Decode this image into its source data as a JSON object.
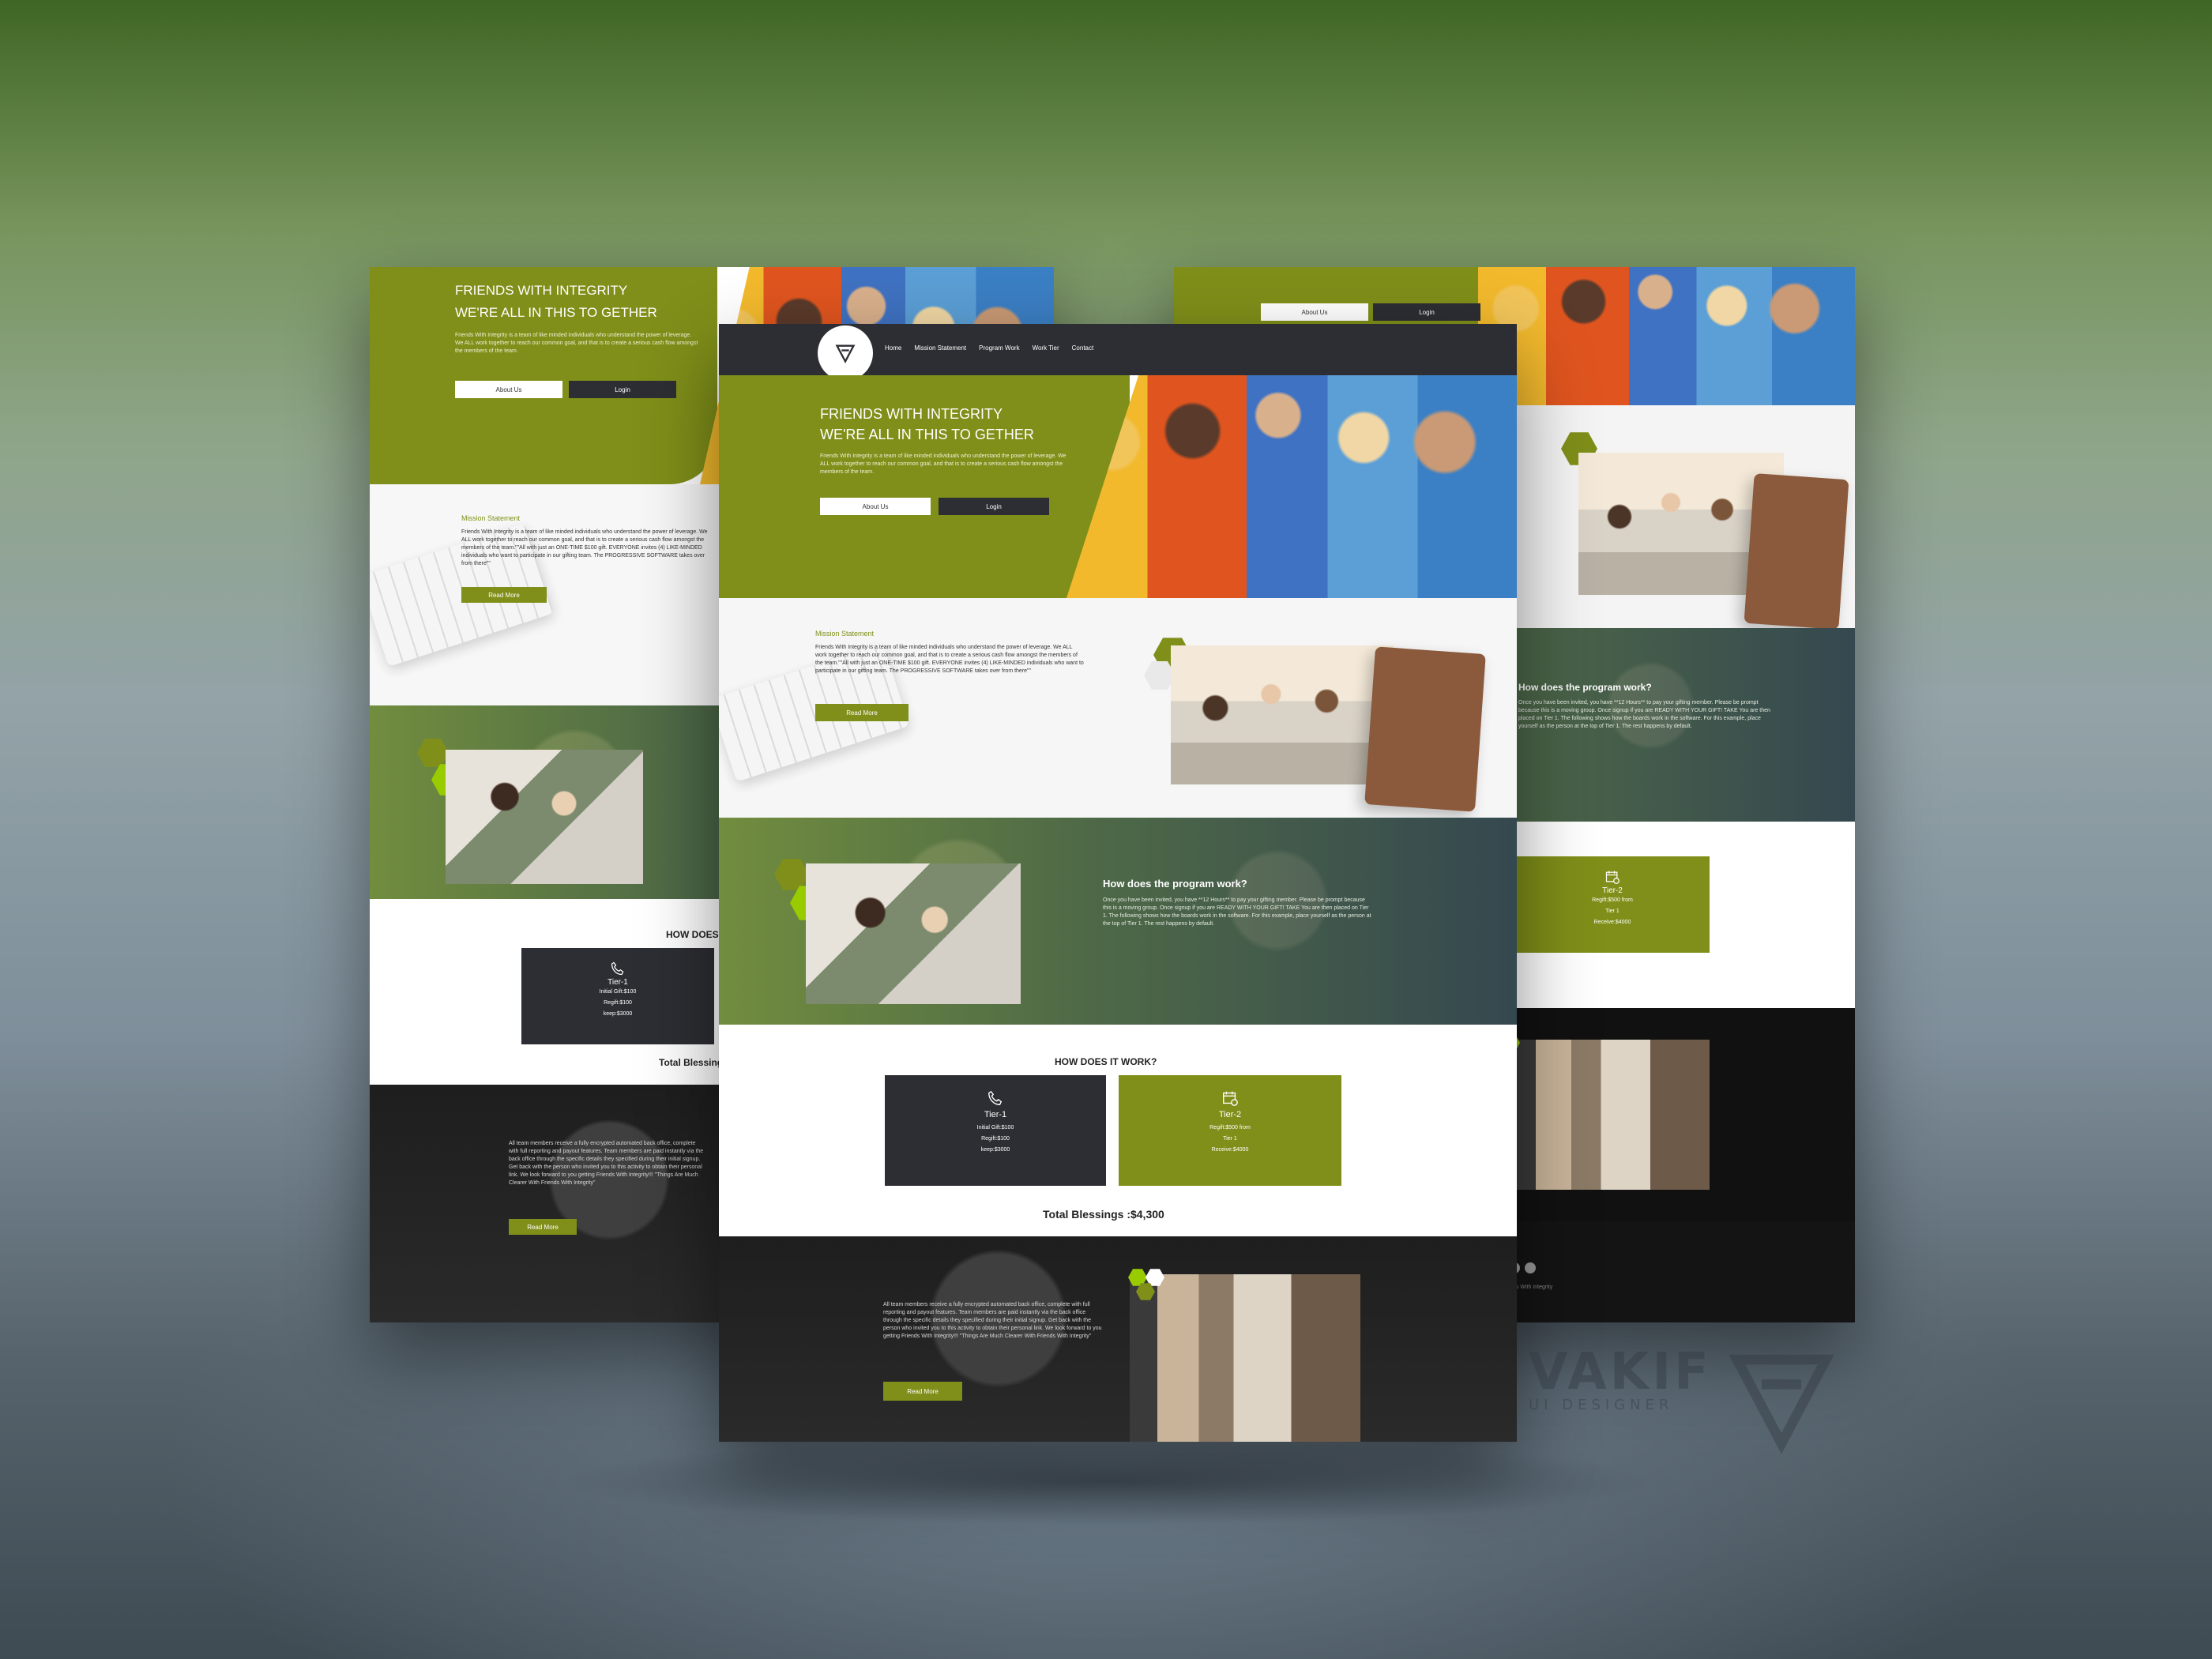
{
  "brand": {
    "green": "#7f8f19",
    "green_dark": "#66771a",
    "dark": "#2d2e33",
    "lime": "#99cc00",
    "logo_icon": "triangle-logo-icon"
  },
  "nav": {
    "items": [
      "Home",
      "Mission Statement",
      "Program Work",
      "Work Tier",
      "Contact"
    ]
  },
  "hero": {
    "title_line1": "FRIENDS WITH INTEGRITY",
    "title_line2": "WE'RE ALL IN THIS TO GETHER",
    "body": "Friends With Integrity is a team of like minded individuals who understand the power of leverage. We ALL work together to reach our common goal, and that is to create a serious cash flow amongst the members of the team.",
    "about_button": "About Us",
    "login_button": "Login"
  },
  "mission": {
    "heading": "Mission Statement",
    "body": "Friends With Integrity is a team of like minded individuals who understand the power of leverage. We ALL work together to reach our common goal, and that is to create a serious cash flow amongst the members of the team.\"\"All with just an ONE-TIME $100 gift. EVERYONE invites (4) LIKE-MINDED individuals who want to participate in our gifting team. The PROGRESSIVE SOFTWARE takes over from there\"\"",
    "read_more": "Read More"
  },
  "program": {
    "heading": "How does the program work?",
    "body": "Once you have been invited, you have **12 Hours** to pay your gifting member. Please be prompt because this is a moving group. Once signup if you are READY WITH YOUR GIFT! TAKE You are then placed on Tier 1. The following shows how the boards work in the software. For this example, place yourself as the person at the top of Tier 1. The rest happens by default."
  },
  "tiers": {
    "heading": "HOW DOES IT WORK?",
    "tier1": {
      "icon": "phone-gift-icon",
      "title": "Tier-1",
      "lines": [
        "Initial Gift:$100",
        "Regift:$100",
        "keep:$3000"
      ]
    },
    "tier2": {
      "icon": "calendar-plus-icon",
      "title": "Tier-2",
      "lines": [
        "Regift:$500 from",
        "Tier 1",
        "Receive:$4000"
      ]
    },
    "total": "Total Blessings :$4,300"
  },
  "team": {
    "body": "All team members receive a fully encrypted automated back office, complete with full reporting and payout features. Team members are paid instantly via the back office through the specific details they specified during their initial signup. Get back with the person who invited you to this activity to obtain their personal link. We look forward to you getting Friends With Integrity!!! \"Things Are Much Clearer With Friends With Integrity\"",
    "read_more": "Read More"
  },
  "footer": {
    "credit": "Design by Friends With Integrity",
    "social_icons": [
      "linkedin-icon",
      "globe-icon"
    ]
  },
  "watermark": {
    "name": "VAKIF",
    "role": "UI DESIGNER"
  }
}
